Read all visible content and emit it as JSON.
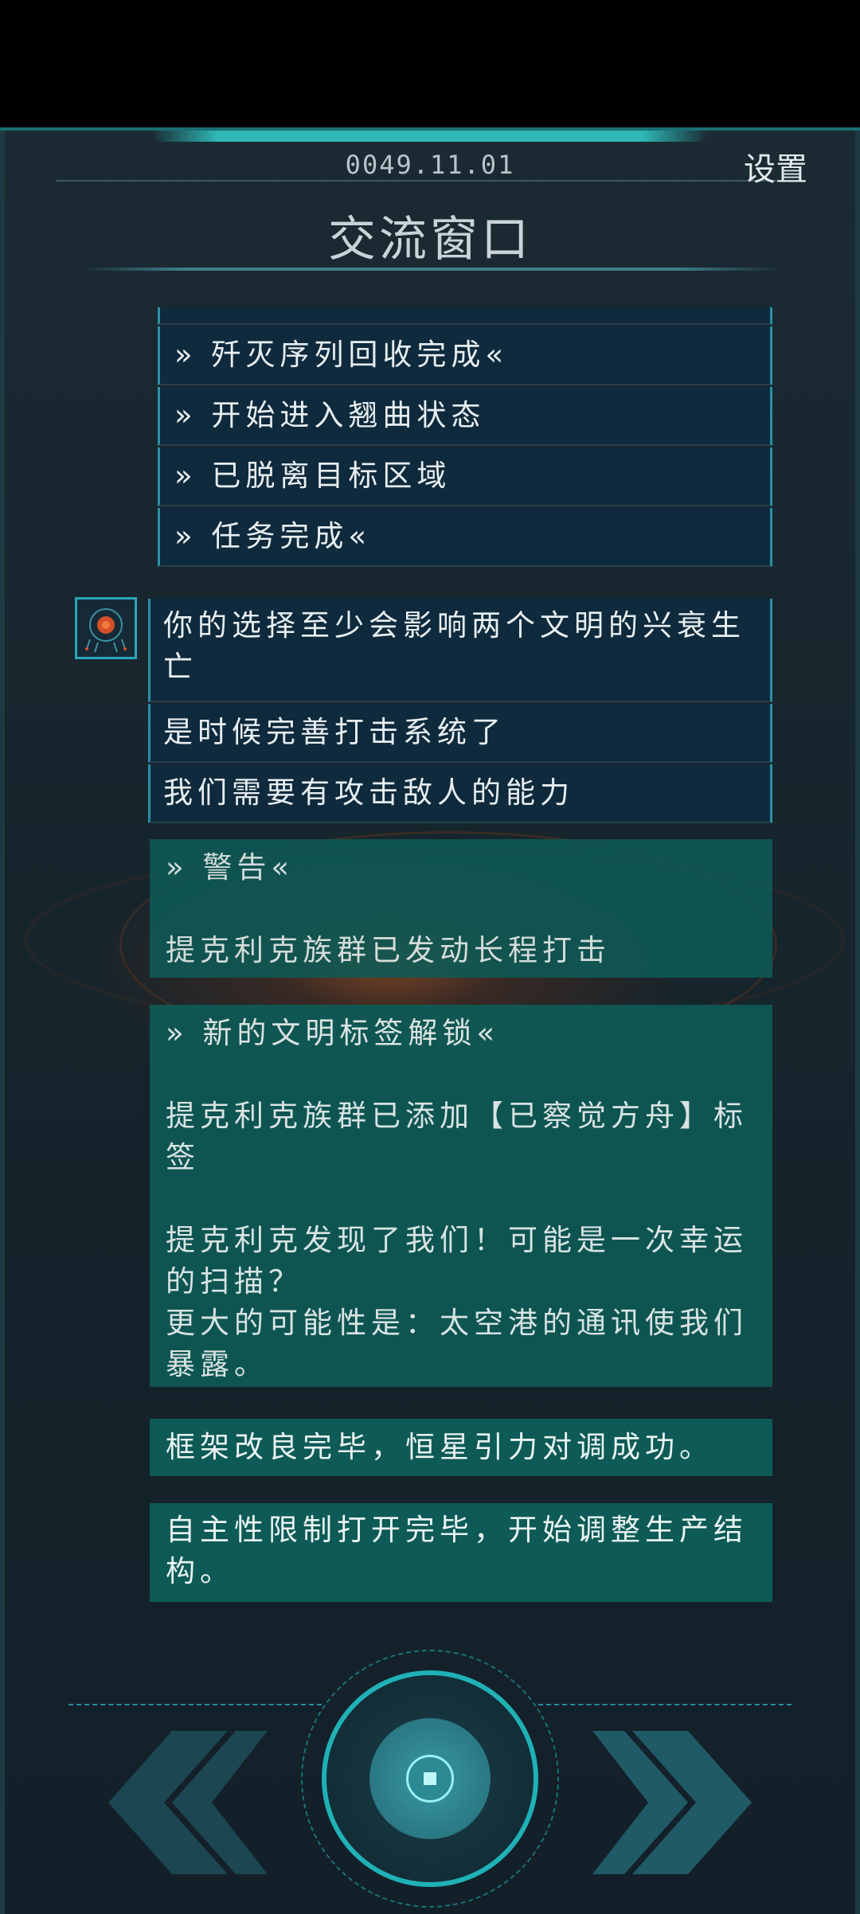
{
  "header": {
    "date": "0049.11.01",
    "settings_label": "设置",
    "title": "交流窗口"
  },
  "log_block": [
    "» 歼灭序列回收完成«",
    "» 开始进入翘曲状态",
    "» 已脱离目标区域",
    "» 任务完成«"
  ],
  "ai_messages": [
    "你的选择至少会影响两个文明的兴衰生亡",
    "是时候完善打击系统了",
    "我们需要有攻击敌人的能力"
  ],
  "warning": {
    "title": "» 警告«",
    "body": "提克利克族群已发动长程打击"
  },
  "unlock": {
    "title": "» 新的文明标签解锁«",
    "line1": "提克利克族群已添加【已察觉方舟】标签",
    "line2": "提克利克发现了我们！可能是一次幸运的扫描？",
    "line3": "更大的可能性是：太空港的通讯使我们暴露。"
  },
  "status_messages": [
    "框架改良完毕，恒星引力对调成功。",
    "自主性限制打开完毕，开始调整生产结构。"
  ],
  "controls": {
    "prev_icon": "double-chevron-left-icon",
    "center_icon": "stop-square-icon",
    "next_icon": "double-chevron-right-icon"
  },
  "colors": {
    "accent": "#1fb1b6",
    "dark_bubble": "#0f2a3c",
    "teal_bubble": "#0e5a56"
  }
}
